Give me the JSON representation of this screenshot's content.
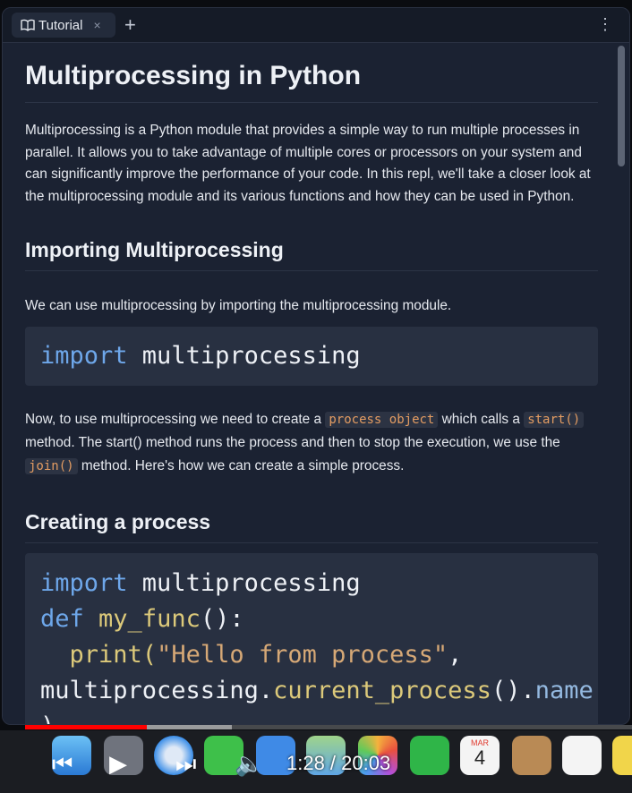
{
  "tab": {
    "label": "Tutorial",
    "close": "×",
    "new": "+",
    "menu": "⋮"
  },
  "doc": {
    "title": "Multiprocessing in Python",
    "intro": "Multiprocessing is a Python module that provides a simple way to run multiple processes in parallel. It allows you to take advantage of multiple cores or processors on your system and can significantly improve the performance of your code. In this repl, we'll take a closer look at the multiprocessing module and its various functions and how they can be used in Python.",
    "h_import": "Importing Multiprocessing",
    "p_import": "We can use multiprocessing by importing the multiprocessing module.",
    "code1": {
      "kw": "import",
      "rest": " multiprocessing"
    },
    "p_create": {
      "t1": "Now, to use multiprocessing we need to create a ",
      "c1": "process object",
      "t2": " which calls a ",
      "c2": "start()",
      "t3": " method. The start() method runs the process and then to stop the execution, we use the ",
      "c3": "join()",
      "t4": " method. Here's how we can create a simple process."
    },
    "h_create": "Creating a process",
    "code2": {
      "l1_kw": "import",
      "l1_rest": " multiprocessing",
      "l2_kw": "def",
      "l2_fn": "my_func",
      "l2_rest": "():",
      "l3_fn": "print",
      "l3_open": "(",
      "l3_str": "\"Hello from process\"",
      "l3_rest": ",",
      "l4_a": "multiprocessing",
      "l4_dot": ".",
      "l4_fn": "current_process",
      "l4_mid": "().",
      "l4_attr": "name",
      "l5": ")"
    }
  },
  "video": {
    "time": "1:28 / 20:03",
    "progress": 0.2,
    "buffered": 0.34
  },
  "dock": {
    "calendar_month": "MAR",
    "calendar_day": "4"
  }
}
